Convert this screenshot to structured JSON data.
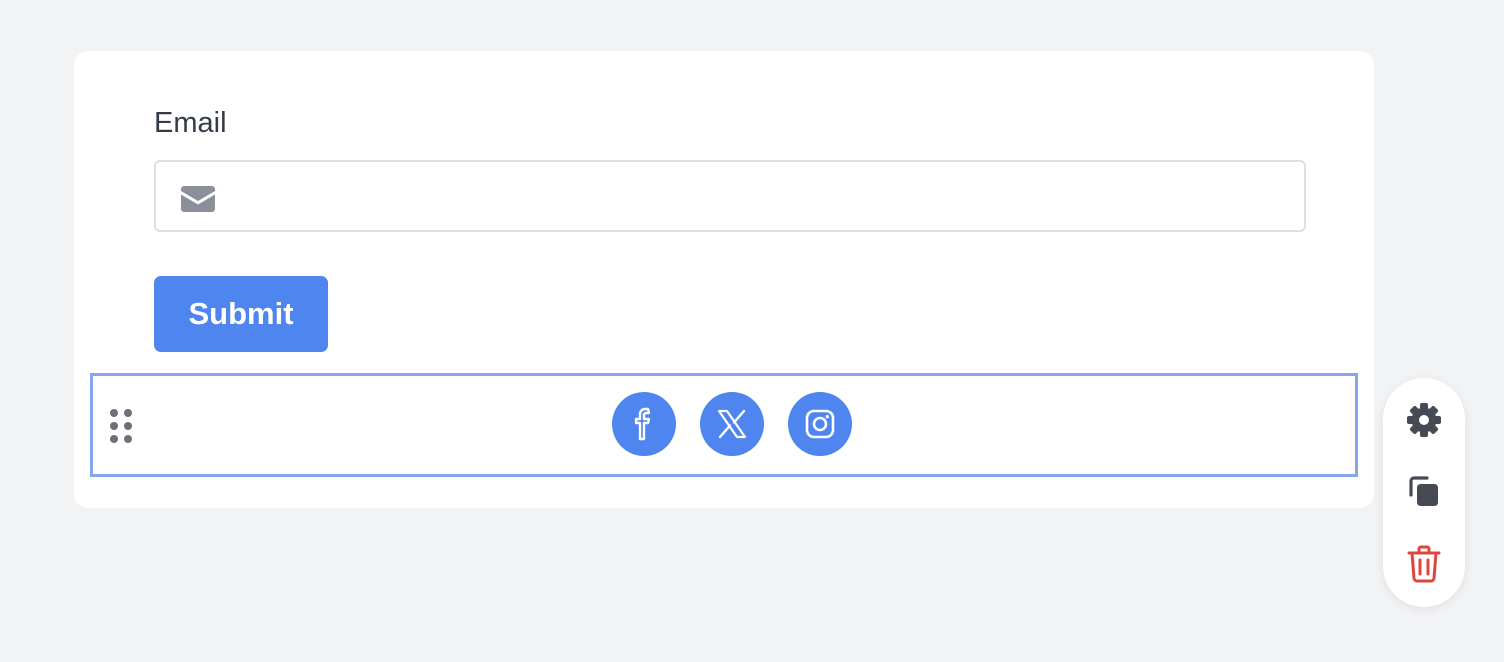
{
  "form": {
    "email_label": "Email",
    "email_value": "",
    "email_placeholder": "",
    "submit_label": "Submit"
  },
  "social_block": {
    "icons": [
      {
        "name": "facebook-icon"
      },
      {
        "name": "x-icon"
      },
      {
        "name": "instagram-icon"
      }
    ],
    "accent_color": "#4f85ee",
    "selection_border_color": "#86a7ec"
  },
  "toolbar": {
    "actions": [
      {
        "name": "settings",
        "icon": "gear-icon"
      },
      {
        "name": "duplicate",
        "icon": "copy-icon"
      },
      {
        "name": "delete",
        "icon": "trash-icon",
        "color": "#e0453d"
      }
    ]
  }
}
